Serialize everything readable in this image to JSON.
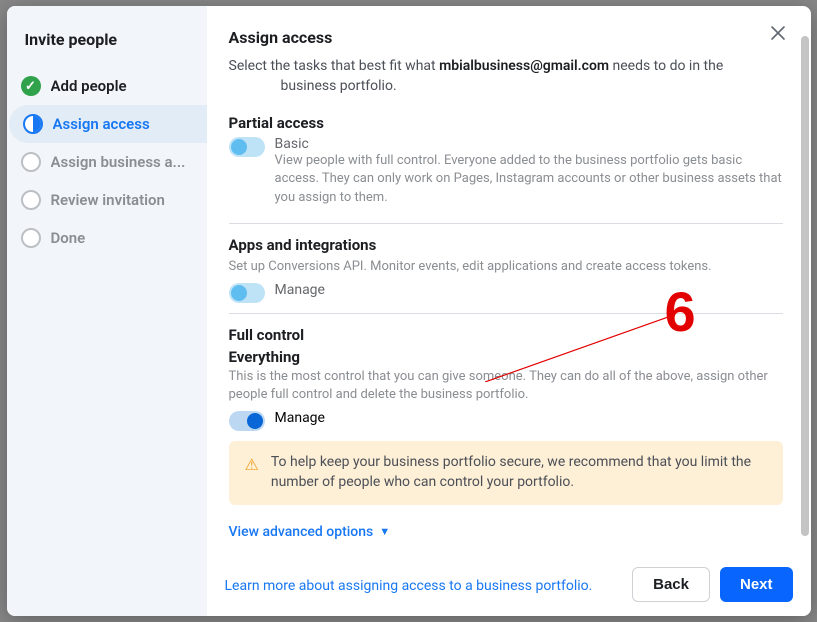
{
  "sidebar": {
    "title": "Invite people",
    "steps": [
      {
        "label": "Add people",
        "state": "done"
      },
      {
        "label": "Assign access",
        "state": "current"
      },
      {
        "label": "Assign business a...",
        "state": "pending"
      },
      {
        "label": "Review invitation",
        "state": "pending"
      },
      {
        "label": "Done",
        "state": "pending"
      }
    ]
  },
  "main": {
    "title": "Assign access",
    "intro_prefix": "Select the tasks that best fit what ",
    "intro_email": "mbialbusiness@gmail.com",
    "intro_suffix": " needs to do in the",
    "intro_line2": "business portfolio.",
    "partial": {
      "title": "Partial access",
      "basic_label": "Basic",
      "basic_desc": "View people with full control. Everyone added to the business portfolio gets basic access. They can only work on Pages, Instagram accounts or other business assets that you assign to them."
    },
    "apps": {
      "title": "Apps and integrations",
      "desc": "Set up Conversions API. Monitor events, edit applications and create access tokens.",
      "toggle_label": "Manage"
    },
    "full": {
      "title": "Full control",
      "subtitle": "Everything",
      "desc": "This is the most control that you can give someone. They can do all of the above, assign other people full control and delete the business portfolio.",
      "toggle_label": "Manage",
      "toggle_on": true
    },
    "warning": "To help keep your business portfolio secure, we recommend that you limit the number of people who can control your portfolio.",
    "advanced_link": "View advanced options",
    "learn_more": "Learn more about assigning access to a business portfolio."
  },
  "footer": {
    "back": "Back",
    "next": "Next"
  },
  "annotation": {
    "number": "6"
  }
}
